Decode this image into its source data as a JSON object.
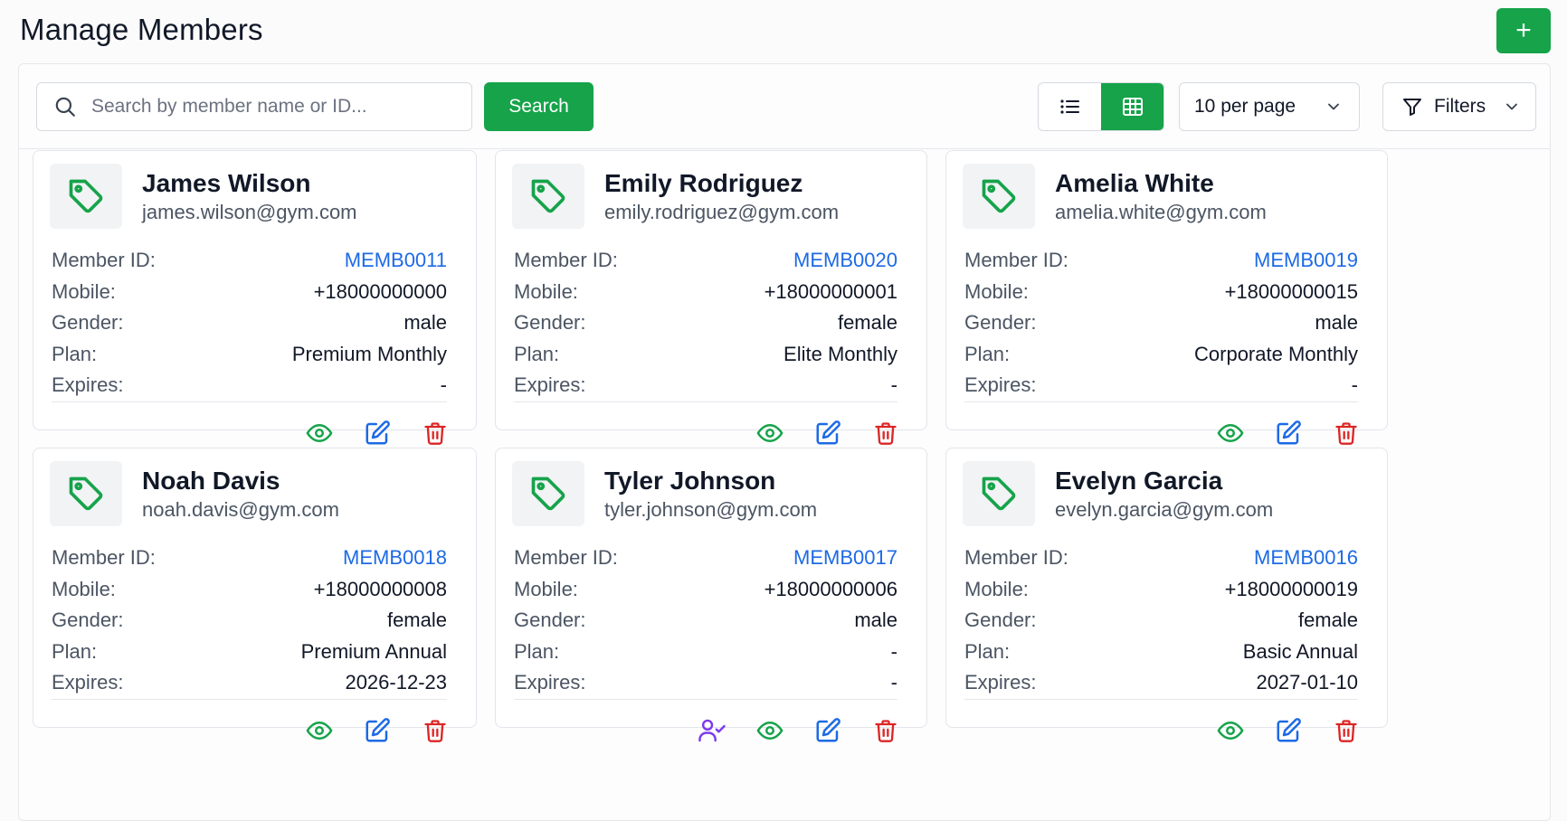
{
  "page": {
    "title": "Manage Members"
  },
  "colors": {
    "primary": "#16a34a",
    "link": "#1d6ae5",
    "danger": "#dc2626",
    "purple": "#7c3aed"
  },
  "toolbar": {
    "add_icon": "plus-icon",
    "add_label": "+",
    "search_placeholder": "Search by member name or ID...",
    "search_value": "",
    "search_button": "Search",
    "view_modes": [
      "list",
      "grid"
    ],
    "view_active": "grid",
    "per_page": "10 per page",
    "filters": "Filters"
  },
  "labels": {
    "member_id": "Member ID:",
    "mobile": "Mobile:",
    "gender": "Gender:",
    "plan": "Plan:",
    "expires": "Expires:"
  },
  "members": [
    {
      "name": "James Wilson",
      "email": "james.wilson@gym.com",
      "member_id": "MEMB0011",
      "mobile": "+18000000000",
      "gender": "male",
      "plan": "Premium Monthly",
      "expires": "-",
      "actions": [
        "view-icon",
        "edit-icon",
        "delete-icon"
      ]
    },
    {
      "name": "Emily Rodriguez",
      "email": "emily.rodriguez@gym.com",
      "member_id": "MEMB0020",
      "mobile": "+18000000001",
      "gender": "female",
      "plan": "Elite Monthly",
      "expires": "-",
      "actions": [
        "view-icon",
        "edit-icon",
        "delete-icon"
      ]
    },
    {
      "name": "Amelia White",
      "email": "amelia.white@gym.com",
      "member_id": "MEMB0019",
      "mobile": "+18000000015",
      "gender": "male",
      "plan": "Corporate Monthly",
      "expires": "-",
      "actions": [
        "view-icon",
        "edit-icon",
        "delete-icon"
      ]
    },
    {
      "name": "Noah Davis",
      "email": "noah.davis@gym.com",
      "member_id": "MEMB0018",
      "mobile": "+18000000008",
      "gender": "female",
      "plan": "Premium Annual",
      "expires": "2026-12-23",
      "actions": [
        "view-icon",
        "edit-icon",
        "delete-icon"
      ]
    },
    {
      "name": "Tyler Johnson",
      "email": "tyler.johnson@gym.com",
      "member_id": "MEMB0017",
      "mobile": "+18000000006",
      "gender": "male",
      "plan": "-",
      "expires": "-",
      "actions": [
        "assign-user-icon",
        "view-icon",
        "edit-icon",
        "delete-icon"
      ]
    },
    {
      "name": "Evelyn Garcia",
      "email": "evelyn.garcia@gym.com",
      "member_id": "MEMB0016",
      "mobile": "+18000000019",
      "gender": "female",
      "plan": "Basic Annual",
      "expires": "2027-01-10",
      "actions": [
        "view-icon",
        "edit-icon",
        "delete-icon"
      ]
    }
  ]
}
